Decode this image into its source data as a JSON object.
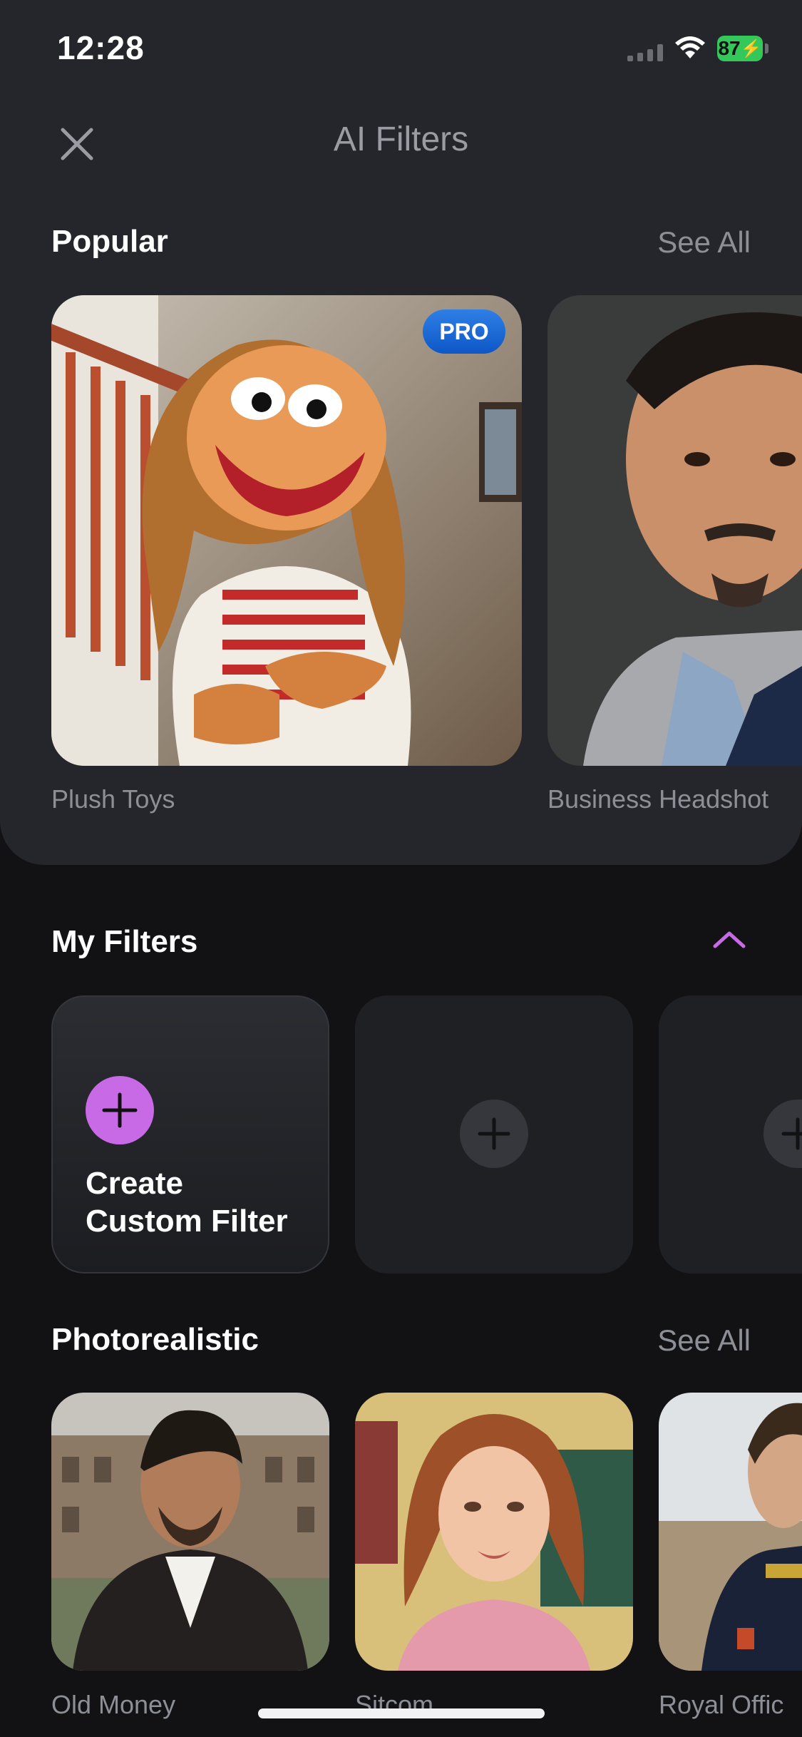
{
  "status_bar": {
    "time": "12:28",
    "battery": "87"
  },
  "header": {
    "title": "AI Filters"
  },
  "popular": {
    "title": "Popular",
    "see_all": "See All",
    "items": [
      {
        "label": "Plush Toys",
        "badge": "PRO"
      },
      {
        "label": "Business Headshot"
      }
    ]
  },
  "my_filters": {
    "title": "My Filters",
    "create_line1": "Create",
    "create_line2": "Custom Filter"
  },
  "photorealistic": {
    "title": "Photorealistic",
    "see_all": "See All",
    "items": [
      {
        "label": "Old Money"
      },
      {
        "label": "Sitcom"
      },
      {
        "label": "Royal Offic"
      }
    ]
  },
  "colors": {
    "accent": "#c86ae6",
    "pro_badge": "#1a6ad8",
    "battery": "#34c759"
  }
}
